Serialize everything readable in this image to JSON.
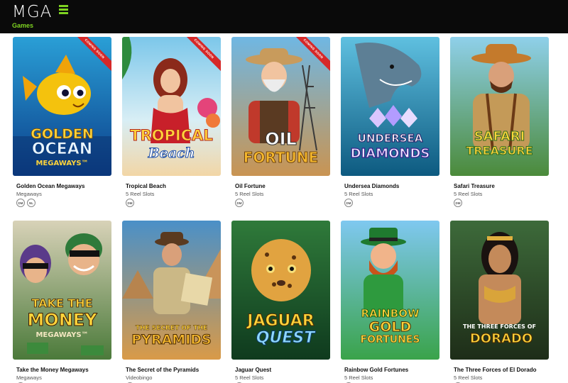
{
  "logo": {
    "text": "MGA",
    "subtitle": "Games",
    "accent": "#7ed321"
  },
  "colors": {
    "ribbon": "#d62828",
    "topbar": "#0a0a0a"
  },
  "games": [
    {
      "title": "Golden Ocean Megaways",
      "category": "Megaways",
      "tags": [
        "DM",
        "NL"
      ],
      "ribbon": "COMING SOON",
      "art_line1": "GOLDEN",
      "art_line2": "OCEAN",
      "art_line3": "MEGAWAYS™"
    },
    {
      "title": "Tropical Beach",
      "category": "5 Reel Slots",
      "tags": [
        "DM"
      ],
      "ribbon": "COMING SOON",
      "art_line1": "TROPICAL",
      "art_line2": "Beach",
      "art_line3": ""
    },
    {
      "title": "Oil Fortune",
      "category": "5 Reel Slots",
      "tags": [
        "DM"
      ],
      "ribbon": "COMING SOON",
      "art_line1": "OIL",
      "art_line2": "FORTUNE",
      "art_line3": ""
    },
    {
      "title": "Undersea Diamonds",
      "category": "5 Reel Slots",
      "tags": [
        "DM"
      ],
      "ribbon": "",
      "art_line1": "UNDERSEA",
      "art_line2": "DIAMONDS",
      "art_line3": ""
    },
    {
      "title": "Safari Treasure",
      "category": "5 Reel Slots",
      "tags": [
        "DM"
      ],
      "ribbon": "",
      "art_line1": "SAFARI",
      "art_line2": "TREASURE",
      "art_line3": ""
    },
    {
      "title": "Take the Money Megaways",
      "category": "Megaways",
      "tags": [
        "DM"
      ],
      "ribbon": "",
      "art_line1": "TAKE THE",
      "art_line2": "MONEY",
      "art_line3": "MEGAWAYS™"
    },
    {
      "title": "The Secret of the Pyramids",
      "category": "Videobingo",
      "tags": [
        "DM"
      ],
      "ribbon": "",
      "art_line1": "THE SECRET OF THE",
      "art_line2": "PYRAMIDS",
      "art_line3": ""
    },
    {
      "title": "Jaguar Quest",
      "category": "5 Reel Slots",
      "tags": [
        "DM"
      ],
      "ribbon": "",
      "art_line1": "JAGUAR",
      "art_line2": "QUEST",
      "art_line3": ""
    },
    {
      "title": "Rainbow Gold Fortunes",
      "category": "5 Reel Slots",
      "tags": [
        "DM"
      ],
      "ribbon": "",
      "art_line1": "RAINBOW",
      "art_line2": "GOLD",
      "art_line3": "FORTUNES"
    },
    {
      "title": "The Three Forces of El Dorado",
      "category": "5 Reel Slots",
      "tags": [
        "DM"
      ],
      "ribbon": "",
      "art_line1": "THE THREE FORCES OF",
      "art_line2": "DORADO",
      "art_line3": ""
    }
  ]
}
